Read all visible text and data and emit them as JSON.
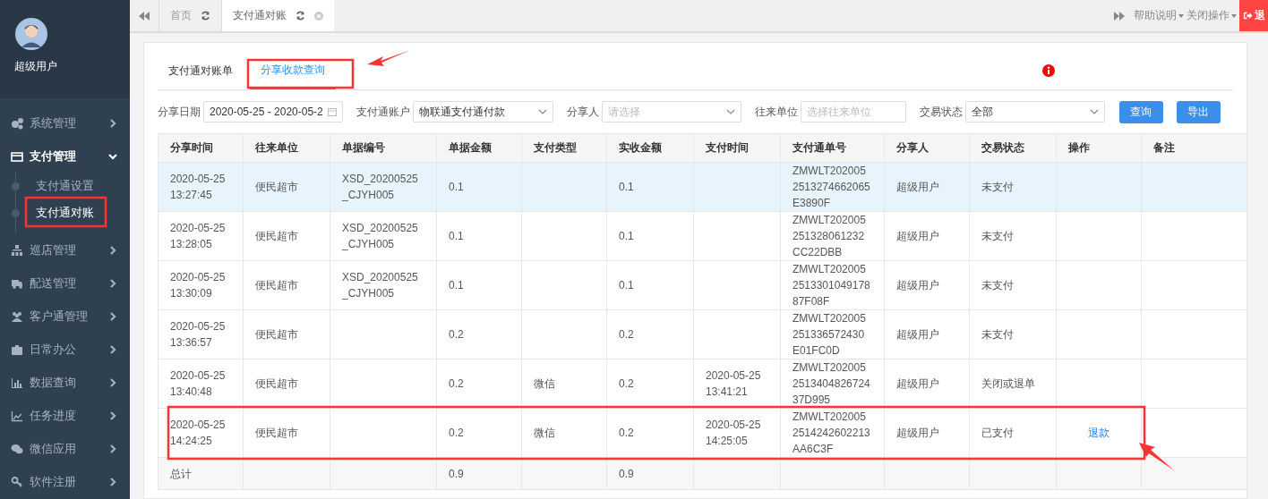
{
  "sidebar": {
    "user": "超级用户",
    "items": [
      {
        "label": "系统管理",
        "expanded": false
      },
      {
        "label": "支付管理",
        "expanded": true,
        "children": [
          {
            "label": "支付通设置",
            "selected": false
          },
          {
            "label": "支付通对账",
            "selected": true
          }
        ]
      },
      {
        "label": "巡店管理",
        "expanded": false
      },
      {
        "label": "配送管理",
        "expanded": false
      },
      {
        "label": "客户通管理",
        "expanded": false
      },
      {
        "label": "日常办公",
        "expanded": false
      },
      {
        "label": "数据查询",
        "expanded": false
      },
      {
        "label": "任务进度",
        "expanded": false
      },
      {
        "label": "微信应用",
        "expanded": false
      },
      {
        "label": "软件注册",
        "expanded": false
      }
    ]
  },
  "page_tabs": [
    {
      "label": "首页",
      "selected": false,
      "closable": false
    },
    {
      "label": "支付通对账",
      "selected": true,
      "closable": true
    }
  ],
  "top_menu": [
    "帮助说明",
    "关闭操作"
  ],
  "logout": "退",
  "inner_tabs": [
    {
      "label": "支付通对账单",
      "selected": false
    },
    {
      "label": "分享收款查询",
      "selected": true
    }
  ],
  "filters": [
    {
      "label": "分享日期",
      "kind": "date",
      "value": "2020-05-25 - 2020-05-2"
    },
    {
      "label": "支付通账户",
      "kind": "select",
      "value": "物联通支付通付款"
    },
    {
      "label": "分享人",
      "kind": "select",
      "placeholder": "请选择"
    },
    {
      "label": "往来单位",
      "kind": "text",
      "placeholder": "选择往来单位"
    },
    {
      "label": "交易状态",
      "kind": "select",
      "value": "全部"
    }
  ],
  "buttons": [
    "查询",
    "导出"
  ],
  "table": {
    "columns": [
      "分享时间",
      "往来单位",
      "单据编号",
      "单据金额",
      "支付类型",
      "实收金额",
      "支付时间",
      "支付通单号",
      "分享人",
      "交易状态",
      "操作",
      "备注"
    ],
    "rows": [
      {
        "selected": true,
        "share_time": "2020-05-25 13:27:45",
        "partner": "便民超市",
        "doc_no": "XSD_20200525 _CJYH005",
        "amount": "0.1",
        "received": "0.1",
        "order_no": "ZMWLT202005 2513274662065 E3890F",
        "sharer": "超级用户",
        "status": "未支付"
      },
      {
        "selected": false,
        "share_time": "2020-05-25 13:28:05",
        "partner": "便民超市",
        "doc_no": "XSD_20200525 _CJYH005",
        "amount": "0.1",
        "received": "0.1",
        "order_no": "ZMWLT202005 251328061232 CC22DBB",
        "sharer": "超级用户",
        "status": "未支付"
      },
      {
        "selected": false,
        "share_time": "2020-05-25 13:30:09",
        "partner": "便民超市",
        "doc_no": "XSD_20200525 _CJYH005",
        "amount": "0.1",
        "received": "0.1",
        "order_no": "ZMWLT202005 2513301049178 87F08F",
        "sharer": "超级用户",
        "status": "未支付"
      },
      {
        "selected": false,
        "share_time": "2020-05-25 13:36:57",
        "partner": "便民超市",
        "amount": "0.2",
        "received": "0.2",
        "order_no": "ZMWLT202005 251336572430 E01FC0D",
        "sharer": "超级用户",
        "status": "未支付"
      },
      {
        "selected": false,
        "share_time": "2020-05-25 13:40:48",
        "partner": "便民超市",
        "amount": "0.2",
        "pay_type": "微信",
        "received": "0.2",
        "pay_time": "2020-05-25 13:41:21",
        "order_no": "ZMWLT202005 2513404826724 37D995",
        "sharer": "超级用户",
        "status": "关闭或退单"
      },
      {
        "selected": false,
        "share_time": "2020-05-25 14:24:25",
        "partner": "便民超市",
        "amount": "0.2",
        "pay_type": "微信",
        "received": "0.2",
        "pay_time": "2020-05-25 14:25:05",
        "order_no": "ZMWLT202005 2514242602213 AA6C3F",
        "sharer": "超级用户",
        "status": "已支付",
        "action": "退款"
      }
    ],
    "total": {
      "share_time": "总计",
      "amount": "0.9",
      "received": "0.9"
    }
  }
}
